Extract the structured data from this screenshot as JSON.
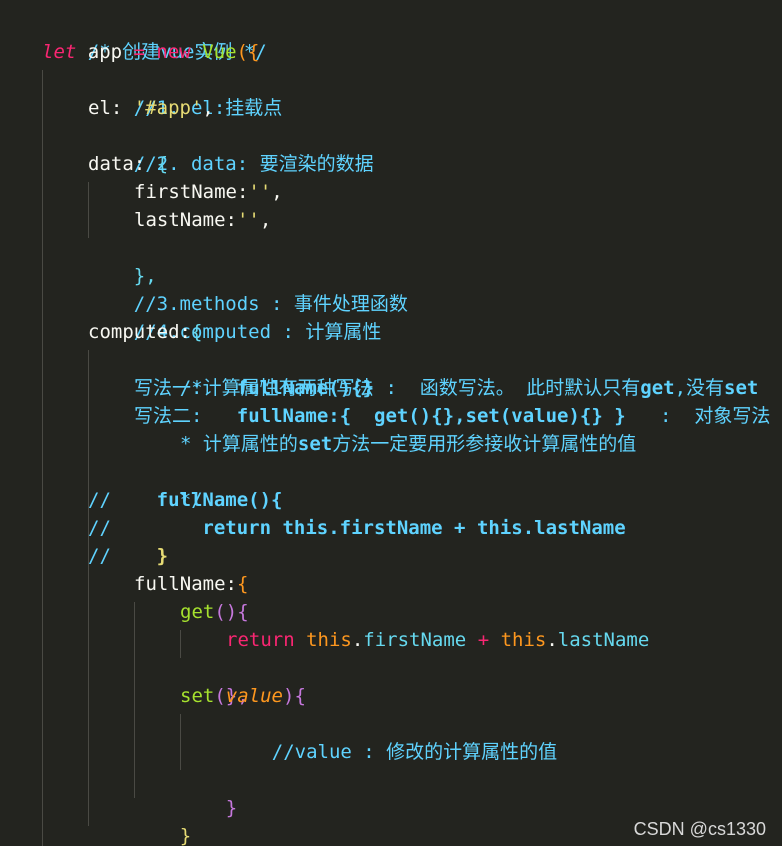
{
  "code": {
    "l1_comment": "/* 创建vue实例 */",
    "l2_let": "let",
    "l2_app": " app ",
    "l2_eq": "=",
    "l2_new": " new ",
    "l2_vue": "Vue",
    "l2_paren": "(",
    "l2_brace": "{",
    "l3_comment": "//1. el:挂载点",
    "l4_key": "el: ",
    "l4_val": "'#app'",
    "l4_comma": ",",
    "l5_comment": "//2. data: 要渲染的数据",
    "l6_key": "data: ",
    "l6_brace": "{",
    "l7_key": "firstName:",
    "l7_val": "''",
    "l7_comma": ",",
    "l8_key": "lastName:",
    "l8_val": "''",
    "l8_comma": ",",
    "l9_close": "},",
    "l10_comment": "//3.methods : 事件处理函数",
    "l11_comment": "//4.computed : 计算属性",
    "l12_key": "computed:",
    "l12_brace": "{",
    "l13_comment": "/*计算属性有两种写法",
    "l14_comment_a": "写法一:   ",
    "l14_fn": "fullName(){}",
    "l14_comment_b": " :  函数写法。 此时默认只有",
    "l14_get": "get",
    "l14_comment_c": ",没有",
    "l14_set": "set",
    "l15_comment_a": "写法二:   ",
    "l15_fn": "fullName:{  get(){},set(value){} }",
    "l15_comment_b": "   :  对象写法",
    "l16_comment_a": "* 计算属性的",
    "l16_set": "set",
    "l16_comment_b": "方法一定要用形参接收计算属性的值",
    "l17_comment": "*/",
    "l18_slash": "//",
    "l18_code": "    fullName(){",
    "l19_slash": "//",
    "l19_code": "        return this.firstName + this.lastName",
    "l20_slash": "//",
    "l20_code": "    }",
    "l21_key": "fullName:",
    "l21_brace": "{",
    "l22_get": "get",
    "l22_paren": "()",
    "l22_brace": "{",
    "l23_return": "return ",
    "l23_this1": "this",
    "l23_dot1": ".",
    "l23_prop1": "firstName",
    "l23_plus": " + ",
    "l23_this2": "this",
    "l23_dot2": ".",
    "l23_prop2": "lastName",
    "l24_close": "},",
    "l25_set": "set",
    "l25_paren_open": "(",
    "l25_param": "value",
    "l25_paren_close": ")",
    "l25_brace": "{",
    "l26_comment": "//value : 修改的计算属性的值",
    "l28_close": "}",
    "l29_close": "}",
    "l30_close": "}"
  },
  "watermark": "CSDN @cs1330"
}
